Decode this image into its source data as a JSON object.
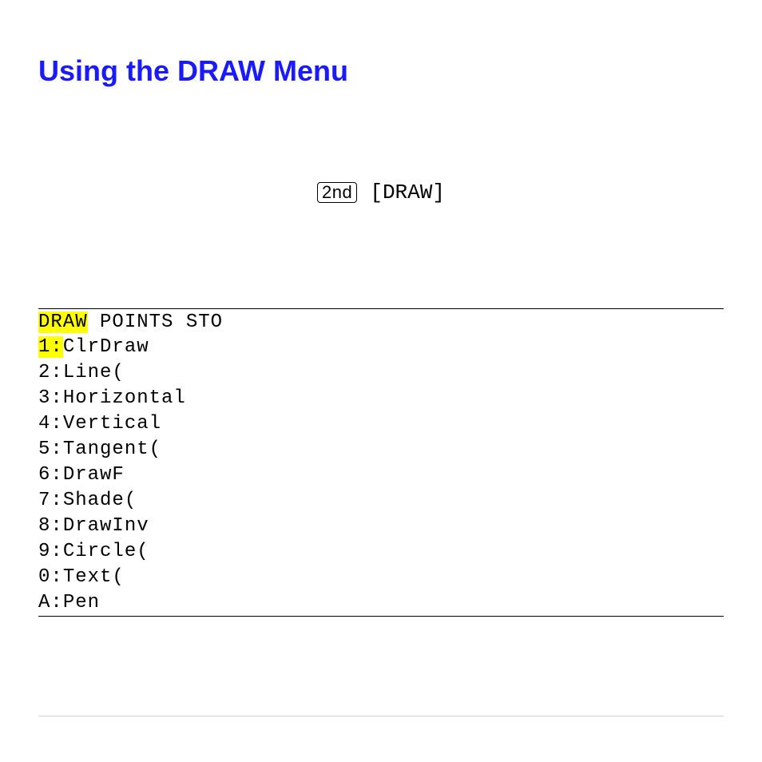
{
  "heading": "Using the DRAW Menu",
  "keys": {
    "second": "2nd",
    "bracket_draw": "[DRAW]"
  },
  "menu": {
    "tabs": {
      "draw": "DRAW",
      "points": "POINTS",
      "sto": "STO"
    },
    "items": [
      {
        "num": "1:",
        "label": "ClrDraw",
        "selected": true
      },
      {
        "num": "2:",
        "label": "Line(",
        "selected": false
      },
      {
        "num": "3:",
        "label": "Horizontal",
        "selected": false
      },
      {
        "num": "4:",
        "label": "Vertical",
        "selected": false
      },
      {
        "num": "5:",
        "label": "Tangent(",
        "selected": false
      },
      {
        "num": "6:",
        "label": "DrawF",
        "selected": false
      },
      {
        "num": "7:",
        "label": "Shade(",
        "selected": false
      },
      {
        "num": "8:",
        "label": "DrawInv",
        "selected": false
      },
      {
        "num": "9:",
        "label": "Circle(",
        "selected": false
      },
      {
        "num": "0:",
        "label": "Text(",
        "selected": false
      },
      {
        "num": "A:",
        "label": "Pen",
        "selected": false
      }
    ]
  }
}
